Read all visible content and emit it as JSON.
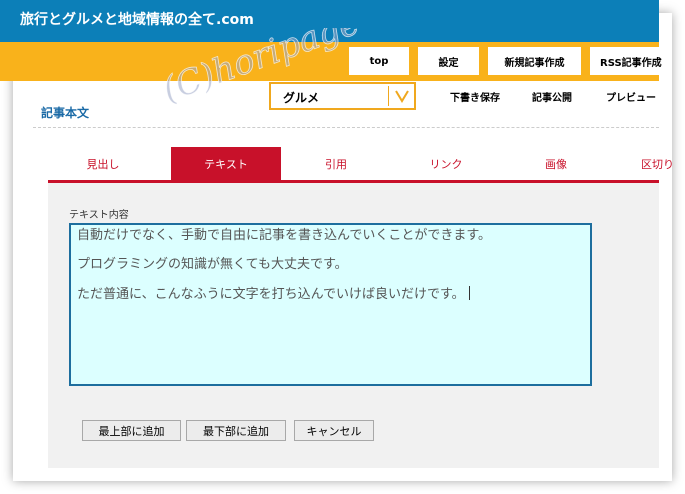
{
  "site": {
    "title": "旅行とグルメと地域情報の全て.com"
  },
  "nav": {
    "buttons": [
      {
        "label": "top"
      },
      {
        "label": "設定"
      },
      {
        "label": "新規記事作成"
      },
      {
        "label": "RSS記事作成"
      }
    ]
  },
  "page": {
    "label": "記事本文"
  },
  "category": {
    "selected": "グルメ",
    "arrow_icon": "chevron-down-icon"
  },
  "actions": [
    {
      "label": "下書き保存"
    },
    {
      "label": "記事公開"
    },
    {
      "label": "プレビュー"
    }
  ],
  "tabs": [
    {
      "label": "見出し",
      "active": false
    },
    {
      "label": "テキスト",
      "active": true
    },
    {
      "label": "引用",
      "active": false
    },
    {
      "label": "リンク",
      "active": false
    },
    {
      "label": "画像",
      "active": false
    },
    {
      "label": "区切り",
      "active": false
    }
  ],
  "editor": {
    "field_label": "テキスト内容",
    "paragraphs": [
      "自動だけでなく、手動で自由に記事を書き込んでいくことができます。",
      "プログラミングの知識が無くても大丈夫です。",
      "ただ普通に、こんなふうに文字を打ち込んでいけば良いだけです。"
    ]
  },
  "buttons": {
    "add_top": "最上部に追加",
    "add_bottom": "最下部に追加",
    "cancel": "キャンセル"
  },
  "watermark": {
    "text": "(C)horipage"
  },
  "colors": {
    "header_blue": "#0c7fb8",
    "nav_orange": "#f9b21b",
    "tab_red": "#c8112a",
    "textarea_bg": "#dcffff",
    "textarea_border": "#1d6e9e"
  }
}
